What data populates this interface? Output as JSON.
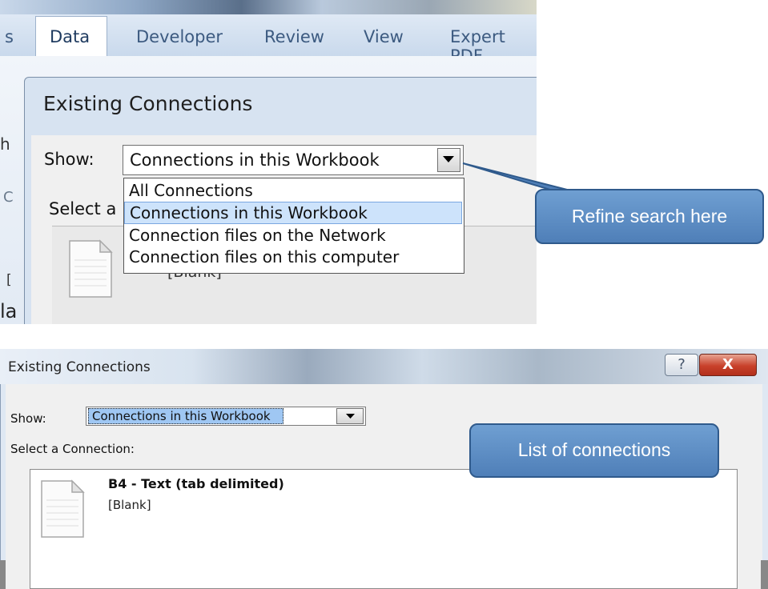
{
  "ribbon": {
    "tabs": [
      "s",
      "Data",
      "Developer",
      "Review",
      "View",
      "Expert PDF"
    ]
  },
  "left_strip": [
    "h",
    "C",
    "[",
    "la"
  ],
  "dialog_top": {
    "title": "Existing Connections",
    "show_label": "Show:",
    "selected_value": "Connections in this Workbook",
    "select_a_label": "Select a",
    "blank_text": "[Blank]",
    "dropdown_options": [
      "All Connections",
      "Connections in this Workbook",
      "Connection files on the Network",
      "Connection files on this computer"
    ],
    "highlighted_option_index": 1
  },
  "callouts": {
    "top": "Refine search here",
    "bottom": "List of connections"
  },
  "dialog_bottom": {
    "title": "Existing Connections",
    "help_glyph": "?",
    "close_glyph": "X",
    "show_label": "Show:",
    "selected_value": "Connections in this Workbook",
    "select_connection_label": "Select a Connection:",
    "connection": {
      "name": "B4 - Text (tab delimited)",
      "description": "[Blank]"
    }
  },
  "colors": {
    "callout_fill": "#5b8cc6",
    "callout_border": "#2f5a8c",
    "highlight": "#cde3fb",
    "close_button": "#c8412b"
  },
  "icons": [
    "dropdown-arrow-icon",
    "document-icon",
    "help-icon",
    "close-icon"
  ]
}
